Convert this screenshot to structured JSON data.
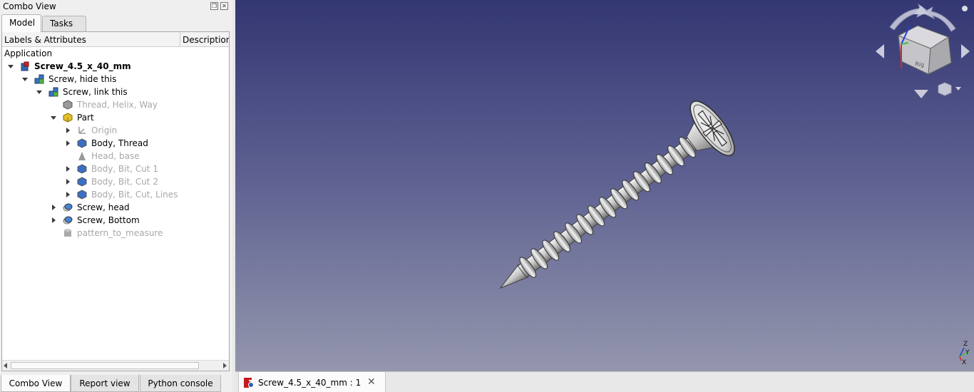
{
  "panel": {
    "title": "Combo View",
    "tabs": [
      "Model",
      "Tasks"
    ],
    "columns": [
      "Labels & Attributes",
      "Description"
    ],
    "root_label": "Application"
  },
  "tree": [
    {
      "label": "Screw_4.5_x_40_mm",
      "icon": "document-icon",
      "state": "expanded",
      "style": "bold"
    },
    {
      "label": "Screw, hide this",
      "icon": "link-group-icon",
      "state": "expanded",
      "style": "normal"
    },
    {
      "label": "Screw, link this",
      "icon": "link-group-icon",
      "state": "expanded",
      "style": "normal"
    },
    {
      "label": "Thread, Helix, Way",
      "icon": "part-feature-icon",
      "state": "leaf",
      "style": "dim"
    },
    {
      "label": "Part",
      "icon": "part-container-icon",
      "state": "expanded",
      "style": "normal"
    },
    {
      "label": "Origin",
      "icon": "origin-axes-icon",
      "state": "collapsed",
      "style": "dim"
    },
    {
      "label": "Body, Thread",
      "icon": "body-icon",
      "state": "collapsed",
      "style": "normal"
    },
    {
      "label": "Head, base",
      "icon": "cone-icon",
      "state": "leaf",
      "style": "dim"
    },
    {
      "label": "Body, Bit, Cut 1",
      "icon": "body-icon",
      "state": "collapsed",
      "style": "dim"
    },
    {
      "label": "Body, Bit, Cut 2",
      "icon": "body-icon",
      "state": "collapsed",
      "style": "dim"
    },
    {
      "label": "Body, Bit, Cut, Lines",
      "icon": "body-icon",
      "state": "collapsed",
      "style": "dim"
    },
    {
      "label": "Screw, head",
      "icon": "boolean-icon",
      "state": "collapsed",
      "style": "normal"
    },
    {
      "label": "Screw, Bottom",
      "icon": "boolean-icon",
      "state": "collapsed",
      "style": "normal"
    },
    {
      "label": "pattern_to_measure",
      "icon": "cylinder-icon",
      "state": "leaf",
      "style": "dim"
    }
  ],
  "bottom_tabs": [
    "Combo View",
    "Report view",
    "Python console"
  ],
  "document_tab": {
    "label": "Screw_4.5_x_40_mm : 1",
    "icon": "freecad-doc-icon"
  },
  "navcube": {
    "face_label": "Rig"
  },
  "axis_labels": {
    "z": "Z",
    "y": "Y",
    "x": "X"
  },
  "colors": {
    "viewport_top": "#333772",
    "viewport_bottom": "#9496ad",
    "axis_x": "#d62a2a",
    "axis_y": "#3fbf3f",
    "axis_z": "#2a3cd6"
  }
}
